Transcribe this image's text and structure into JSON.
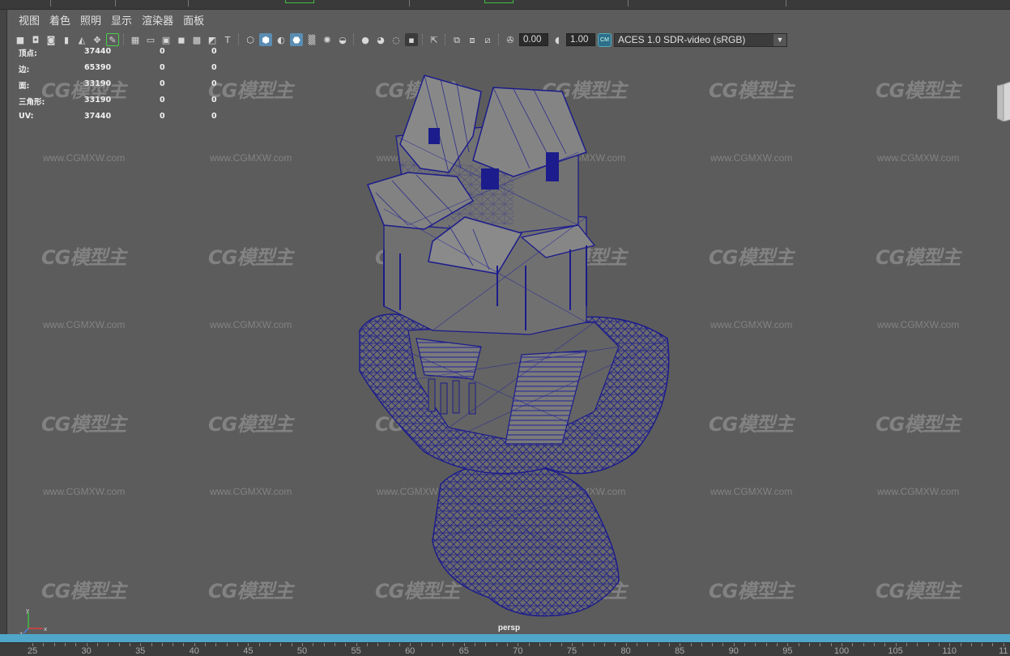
{
  "menu": [
    "视图",
    "着色",
    "照明",
    "显示",
    "渲染器",
    "面板"
  ],
  "toolbar": {
    "exposure_value": "0.00",
    "gamma_value": "1.00",
    "color_space": "ACES 1.0 SDR-video (sRGB)",
    "icons": [
      "camera-icon",
      "camera-attr-icon",
      "bookmark-icon",
      "image-plane-icon",
      "grid-icon",
      "film-gate-icon",
      "resolution-gate-icon",
      "gate-mask-icon",
      "field-chart-icon",
      "safe-action-icon",
      "safe-title-icon",
      "wireframe-icon",
      "smooth-shade-icon",
      "default-material-icon",
      "wireframe-on-shaded-icon",
      "xray-icon",
      "textured-icon",
      "lights-icon",
      "shadows-icon",
      "ambient-occlusion-icon",
      "motion-blur-icon",
      "antialias-icon",
      "isolate-icon",
      "xray-joints-icon",
      "xray-active-icon",
      "exposure-icon",
      "gamma-icon",
      "color-management-icon"
    ]
  },
  "hud": {
    "rows": [
      {
        "label": "顶点:",
        "v1": "37440",
        "v2": "0",
        "v3": "0"
      },
      {
        "label": "边:",
        "v1": "65390",
        "v2": "0",
        "v3": "0"
      },
      {
        "label": "面:",
        "v1": "33190",
        "v2": "0",
        "v3": "0"
      },
      {
        "label": "三角形:",
        "v1": "33190",
        "v2": "0",
        "v3": "0"
      },
      {
        "label": "UV:",
        "v1": "37440",
        "v2": "0",
        "v3": "0"
      }
    ]
  },
  "watermark": {
    "logo": "CG模型主",
    "url": "www.CGMXW.com"
  },
  "camera_label": "persp",
  "axis": {
    "x": "x",
    "y": "y",
    "z": "z"
  },
  "ruler": [
    "25",
    "30",
    "35",
    "40",
    "45",
    "50",
    "55",
    "60",
    "65",
    "70",
    "75",
    "80",
    "85",
    "90",
    "95",
    "100",
    "105",
    "110",
    "11"
  ],
  "colors": {
    "viewport": "#5c5c5c",
    "wire": "#1c1c8c",
    "timebar": "#4fa6c9",
    "active_icon": "#5a8db3"
  }
}
